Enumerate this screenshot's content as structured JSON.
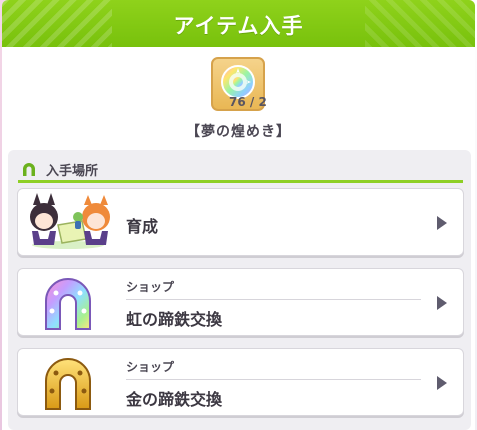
{
  "dialog": {
    "title": "アイテム入手"
  },
  "item": {
    "icon": "rainbow-medal-icon",
    "count": "76 / 2",
    "name": "【夢の煌めき】"
  },
  "section": {
    "label": "入手場所",
    "icon": "horseshoe-icon"
  },
  "sources": [
    {
      "label": "育成",
      "icon": "trainee-characters-icon"
    },
    {
      "sub_label": "ショップ",
      "label": "虹の蹄鉄交換",
      "icon": "rainbow-horseshoe-icon"
    },
    {
      "sub_label": "ショップ",
      "label": "金の蹄鉄交換",
      "icon": "gold-horseshoe-icon"
    }
  ],
  "colors": {
    "header_green": "#80c814",
    "text_dark": "#3c3842",
    "accent_line": "#8ecf25"
  }
}
